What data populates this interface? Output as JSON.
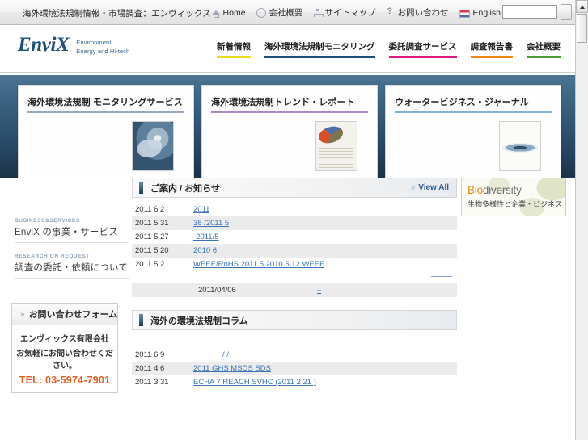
{
  "browser": {
    "title": "海外環境法規制情報・市場調査：エンヴィックス",
    "nav": [
      {
        "label": "Home",
        "icon": "home-icon"
      },
      {
        "label": "会社概要",
        "icon": "info-icon"
      },
      {
        "label": "サイトマップ",
        "icon": "sitemap-icon"
      },
      {
        "label": "お問い合わせ",
        "icon": "question-icon"
      },
      {
        "label": "English",
        "icon": "flag-icon"
      }
    ],
    "search_value": "",
    "search_placeholder": ""
  },
  "header": {
    "logo_main": "EnviX",
    "logo_tagline_1": "Environment,",
    "logo_tagline_2": "Energy and Hi-tech",
    "nav": [
      {
        "label": "新着情報",
        "color": "#e8dd1c"
      },
      {
        "label": "海外環境法規制モニタリング",
        "color": "#1f4e79"
      },
      {
        "label": "委託調査サービス",
        "color": "#e0197f"
      },
      {
        "label": "調査報告書",
        "color": "#f0871a"
      },
      {
        "label": "会社概要",
        "color": "#4a9a3a"
      }
    ]
  },
  "hero": {
    "cards": [
      {
        "title": "海外環境法規制 モニタリングサービス",
        "rule_color": "#9aa9bc",
        "thumb": "globe-thumbnail"
      },
      {
        "title": "海外環境法規制トレンド・レポート",
        "rule_color": "#a98cc0",
        "thumb": "report-thumbnail"
      },
      {
        "title": "ウォータービジネス・ジャーナル",
        "rule_color": "#7fb3cf",
        "thumb": "water-thumbnail"
      }
    ]
  },
  "sidebar": {
    "links": [
      {
        "eyebrow": "BUSINESS&SERVICES",
        "title": "EnviX の事業・サービス"
      },
      {
        "eyebrow": "RESEARCH ON REQUEST",
        "title": "調査の委託・依頼について"
      }
    ],
    "contact": {
      "heading": "お問い合わせフォーム",
      "chevron": "»",
      "company": "エンヴィックス有限会社",
      "note": "お気軽にお問い合わせください。",
      "tel": "TEL: 03-5974-7901",
      "tel_color": "#e8601f"
    }
  },
  "news_section": {
    "title": "ご案内 / お知らせ",
    "view_all": "View All",
    "view_all_chevron": "»",
    "rows": [
      {
        "date": "2011 6 2",
        "link": "2011"
      },
      {
        "date": "2011 5 31",
        "link": "38 /2011 5"
      },
      {
        "date": "2011 5 27",
        "link": "-2011/5"
      },
      {
        "date": "2011 5 20",
        "link": "2010    6"
      },
      {
        "date": "2011 5 2",
        "link": "WEEE/RoHS  2011 5  2010 5 12 WEEE"
      }
    ],
    "extra_row": {
      "date": "2011/04/06",
      "link": "–"
    }
  },
  "column_section": {
    "title": "海外の環境法規制コラム",
    "rows": [
      {
        "date": "2011 6 9",
        "link": "/ /"
      },
      {
        "date": "2011 4 6",
        "link": "2011   GHS MSDS    SDS"
      },
      {
        "date": "2011 3 31",
        "link": "ECHA 7  REACH  SVHC     (2011 2 21 )"
      }
    ]
  },
  "right_banner": {
    "title_part1": "Bio",
    "title_part2": "diversity",
    "subtitle": "生物多様性と企業・ビジネス"
  }
}
